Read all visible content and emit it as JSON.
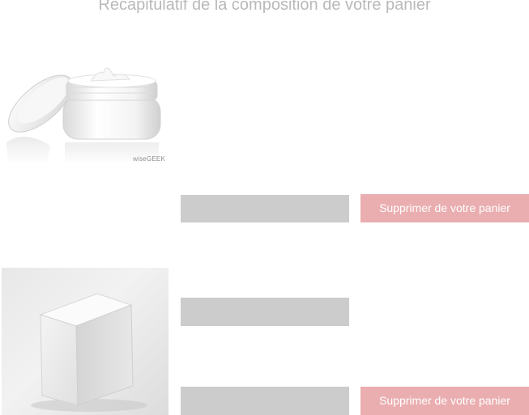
{
  "cart": {
    "title": "Récapitulatif de la composition de votre panier",
    "items": [
      {
        "image_icon": "cream-jar-image",
        "image_watermark": "wiseGEEK",
        "remove_label": "Supprimer de votre panier"
      },
      {
        "image_icon": "white-box-image",
        "remove_label": "Supprimer de votre panier"
      }
    ]
  },
  "colors": {
    "title_text": "#b9b9b9",
    "field_background": "#cccccc",
    "remove_button_background": "#eaaeb0",
    "remove_button_text": "#ffffff"
  }
}
